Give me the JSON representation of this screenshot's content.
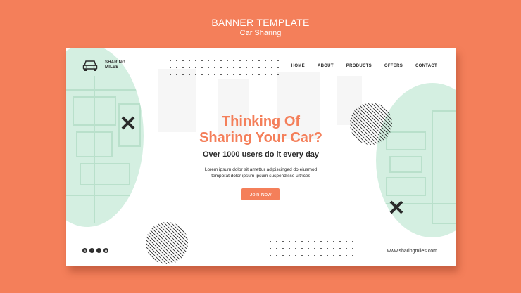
{
  "header": {
    "title": "BANNER TEMPLATE",
    "subtitle": "Car Sharing"
  },
  "logo": {
    "text": "SHARING MILES",
    "icon": "car-icon"
  },
  "nav": {
    "items": [
      "HOME",
      "ABOUT",
      "PRODUCTS",
      "OFFERS",
      "CONTACT"
    ]
  },
  "hero": {
    "headline_line1": "Thinking Of",
    "headline_line2": "Sharing Your Car?",
    "subheadline": "Over 1000 users do it every day",
    "body_line1": "Lorem ipsum dolor sit amettur adipiscinged do eiusmod",
    "body_line2": "temporat dolor ipsum ipsum suspendisse ultrices",
    "cta_label": "Join Now"
  },
  "footer": {
    "socials": [
      "instagram-icon",
      "facebook-icon",
      "twitter-icon",
      "web-icon"
    ],
    "website": "www.sharingmiles.com"
  },
  "colors": {
    "background": "#f47f5a",
    "accent": "#f47f5a",
    "mint": "#d4efe1",
    "mint_line": "#b9e0cb",
    "dark": "#2a2a2a"
  }
}
